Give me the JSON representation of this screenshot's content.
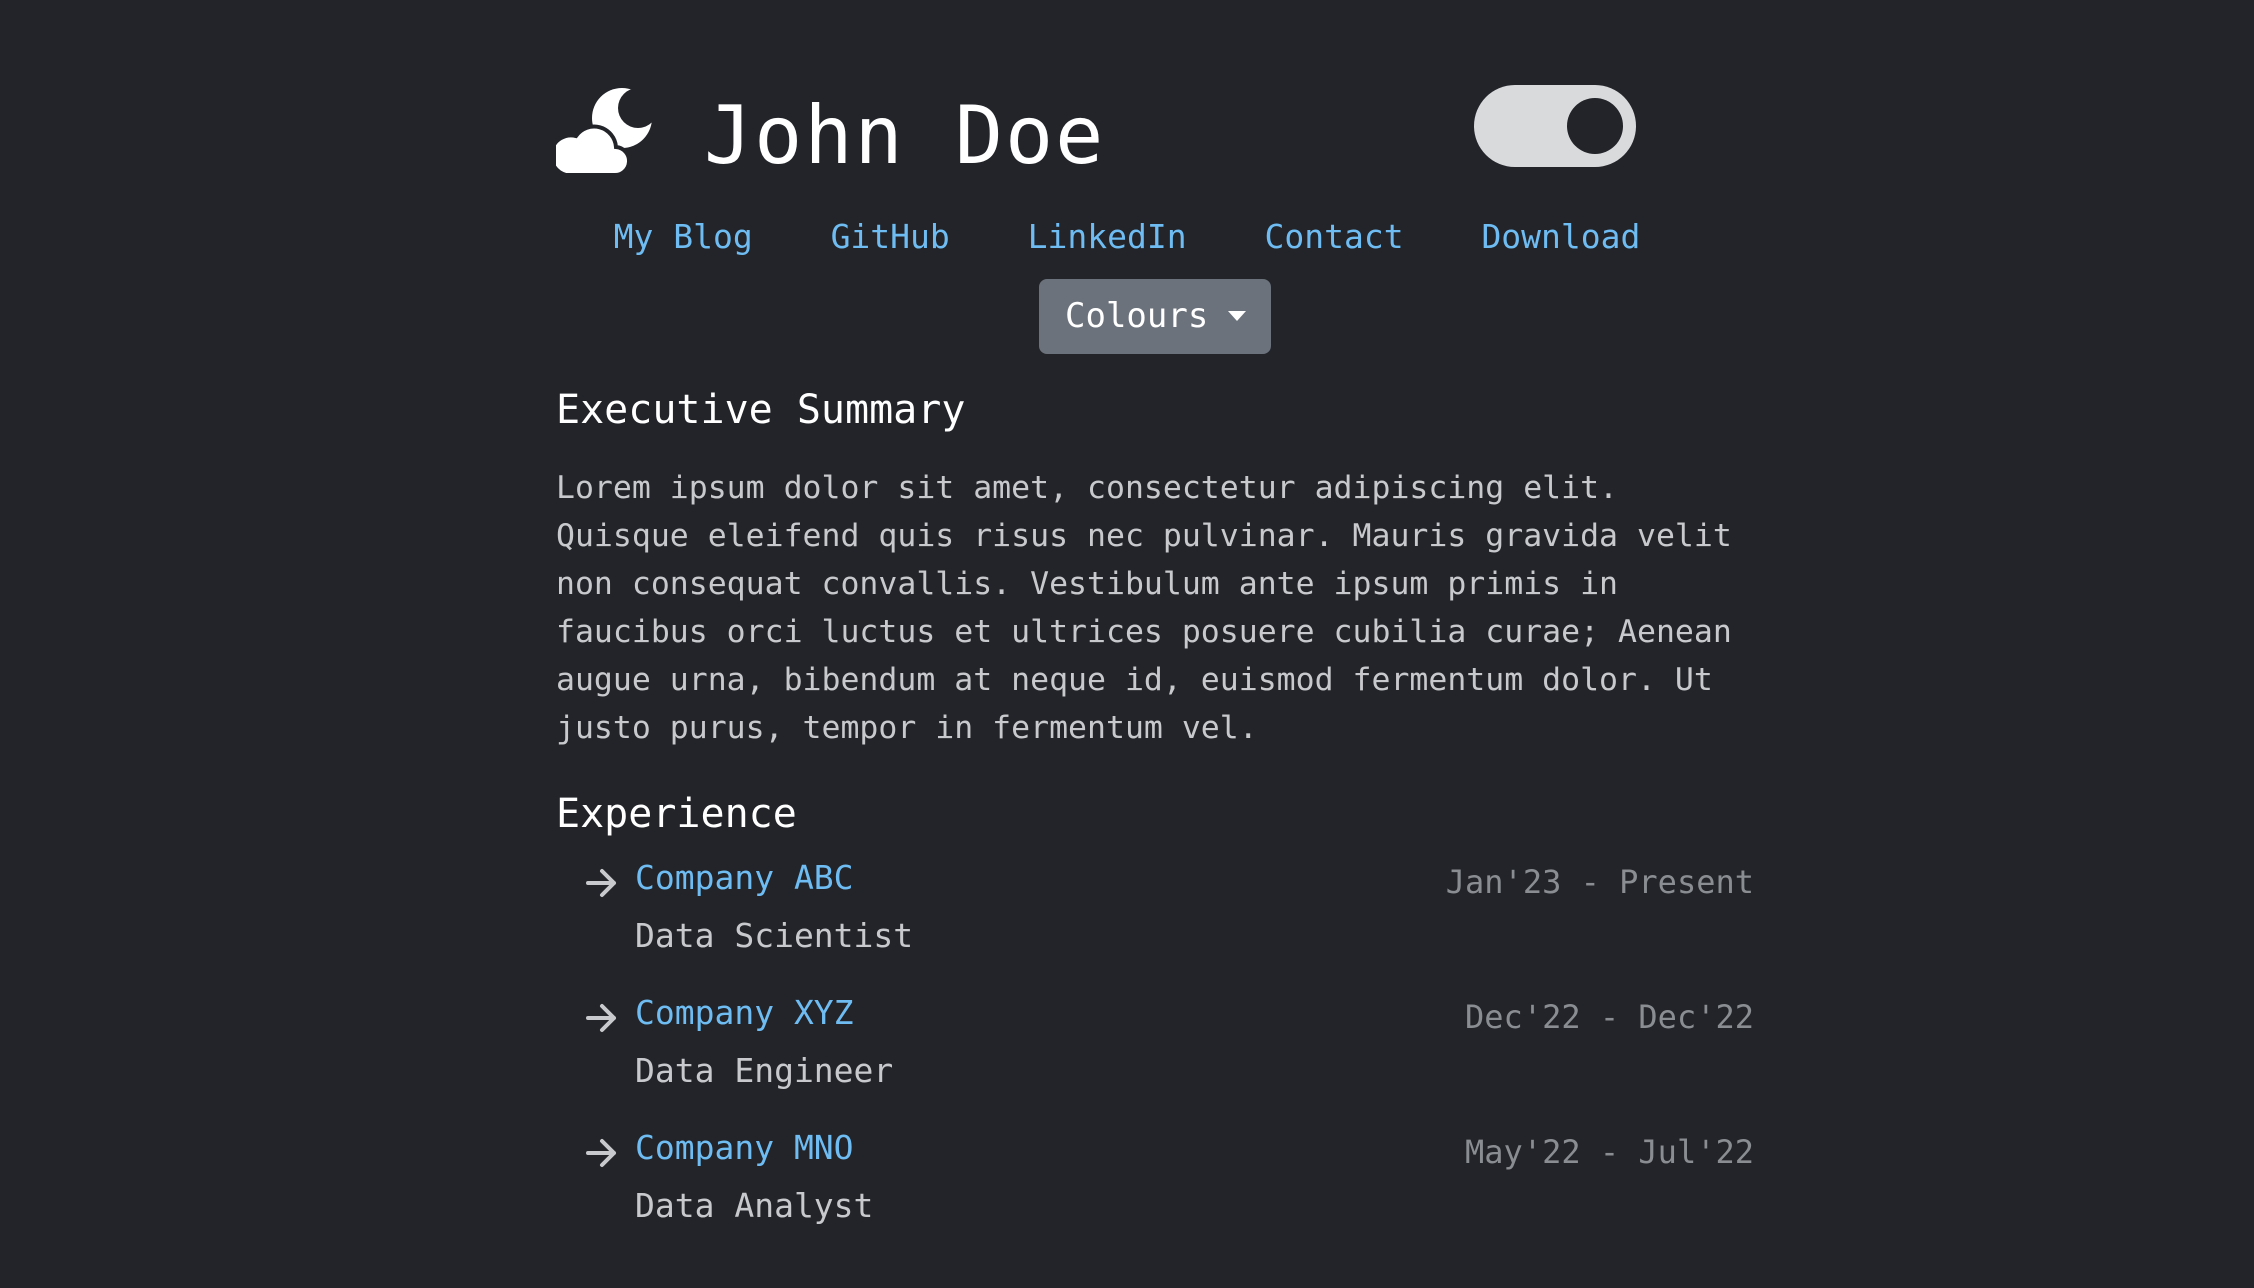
{
  "header": {
    "name": "John Doe",
    "theme_icon": "cloud-moon-icon",
    "theme_toggle_state": "on"
  },
  "nav": {
    "links": [
      "My Blog",
      "GitHub",
      "LinkedIn",
      "Contact",
      "Download"
    ]
  },
  "colours_dropdown": {
    "label": "Colours",
    "icon": "caret-down-icon"
  },
  "summary": {
    "title": "Executive Summary",
    "text": "Lorem ipsum dolor sit amet, consectetur adipiscing elit. Quisque eleifend quis risus nec pulvinar. Mauris gravida velit non consequat convallis. Vestibulum ante ipsum primis in faucibus orci luctus et ultrices posuere cubilia curae; Aenean augue urna, bibendum at neque id, euismod fermentum dolor. Ut justo purus, tempor in fermentum vel."
  },
  "experience": {
    "title": "Experience",
    "item_icon": "arrow-right-icon",
    "items": [
      {
        "company": "Company ABC",
        "role": "Data Scientist",
        "dates": "Jan'23 - Present"
      },
      {
        "company": "Company XYZ",
        "role": "Data Engineer",
        "dates": "Dec'22 - Dec'22"
      },
      {
        "company": "Company MNO",
        "role": "Data Analyst",
        "dates": "May'22 - Jul'22"
      }
    ]
  },
  "colors": {
    "background": "#222429",
    "link": "#6ebcf2",
    "text_muted": "#c8c9cc",
    "date_text": "#8a8d92",
    "dropdown_bg": "#6c727b",
    "toggle_bg": "#d9dadc"
  }
}
